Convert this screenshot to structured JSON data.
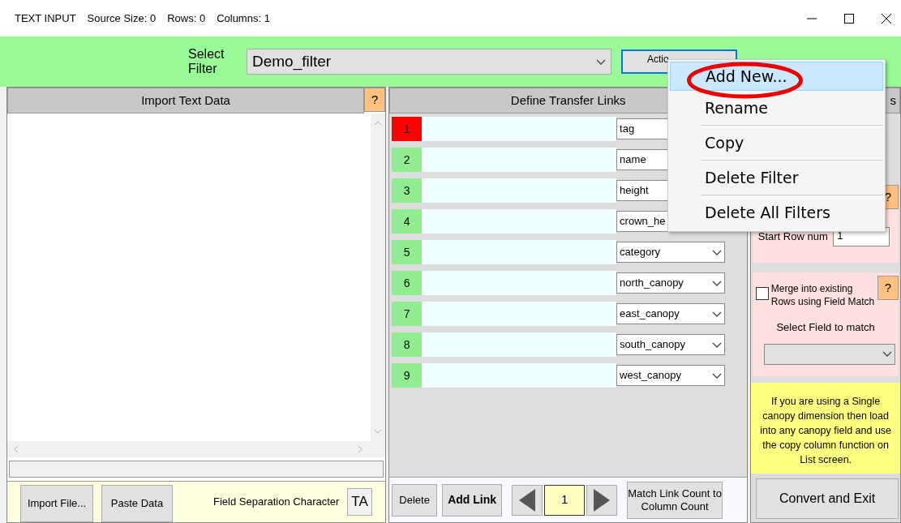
{
  "window": {
    "title": "TEXT INPUT",
    "info": [
      "Source Size: 0",
      "Rows: 0",
      "Columns: 1"
    ]
  },
  "filter": {
    "label": "Select Filter",
    "value": "Demo_filter",
    "actions_button": "Actio"
  },
  "menu": [
    {
      "label": "Add New...",
      "selected": true
    },
    {
      "label": "Rename",
      "selected": false
    },
    {
      "label": "Copy",
      "selected": false
    },
    {
      "label": "Delete Filter",
      "selected": false
    },
    {
      "label": "Delete All Filters",
      "selected": false
    }
  ],
  "import_panel": {
    "title": "Import Text Data",
    "help": "?",
    "buttons": [
      "Import File...",
      "Paste Data"
    ],
    "separator_label": "Field Separation Character",
    "separator_value": "TA"
  },
  "links_panel": {
    "title": "Define Transfer Links",
    "rows": [
      {
        "number": "1",
        "field": "tag",
        "error": true
      },
      {
        "number": "2",
        "field": "name",
        "error": false
      },
      {
        "number": "3",
        "field": "height",
        "error": false
      },
      {
        "number": "4",
        "field": "crown_he",
        "error": false
      },
      {
        "number": "5",
        "field": "category",
        "error": false
      },
      {
        "number": "6",
        "field": "north_canopy",
        "error": false
      },
      {
        "number": "7",
        "field": "east_canopy",
        "error": false
      },
      {
        "number": "8",
        "field": "south_canopy",
        "error": false
      },
      {
        "number": "9",
        "field": "west_canopy",
        "error": false
      }
    ],
    "delete_button": "Delete",
    "add_button": "Add Link",
    "page": "1",
    "match_button": "Match Link Count to Column Count"
  },
  "options_panel": {
    "title": "s",
    "start_row": {
      "label": "Start Row num",
      "value": "1",
      "help": "?"
    },
    "merge": {
      "label": "Merge into existing Rows using Field Match",
      "checked": false,
      "help": "?"
    },
    "match_label": "Select Field to match",
    "note": "If you are using a Single canopy dimension then load into any canopy field and use the copy column function on List screen.",
    "convert_button": "Convert and Exit"
  }
}
